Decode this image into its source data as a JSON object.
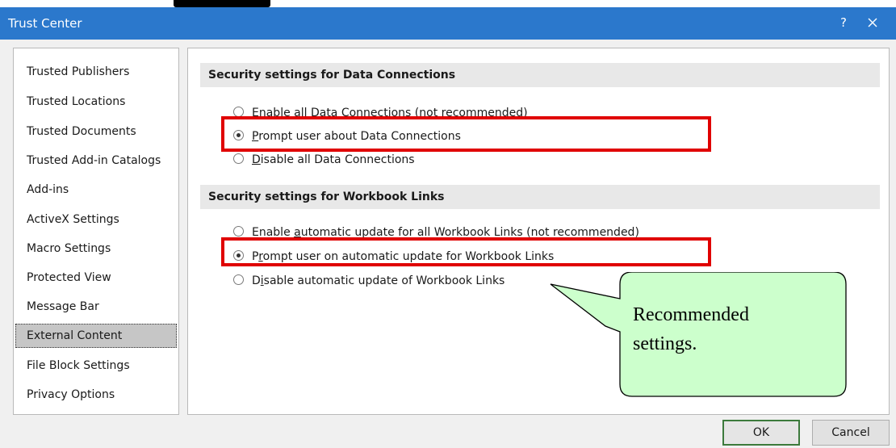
{
  "window": {
    "title": "Trust Center",
    "help_label": "?"
  },
  "sidebar": {
    "items": [
      {
        "label": "Trusted Publishers"
      },
      {
        "label": "Trusted Locations"
      },
      {
        "label": "Trusted Documents"
      },
      {
        "label": "Trusted Add-in Catalogs"
      },
      {
        "label": "Add-ins"
      },
      {
        "label": "ActiveX Settings"
      },
      {
        "label": "Macro Settings"
      },
      {
        "label": "Protected View"
      },
      {
        "label": "Message Bar"
      },
      {
        "label": "External Content",
        "selected": true
      },
      {
        "label": "File Block Settings"
      },
      {
        "label": "Privacy Options"
      }
    ]
  },
  "data_connections": {
    "header": "Security settings for Data Connections",
    "options": [
      {
        "key": "E",
        "rest": "nable all Data Connections (not recommended)",
        "selected": false
      },
      {
        "key": "P",
        "rest": "rompt user about Data Connections",
        "selected": true
      },
      {
        "key": "D",
        "rest": "isable all Data Connections",
        "selected": false
      }
    ]
  },
  "workbook_links": {
    "header": "Security settings for Workbook Links",
    "options": [
      {
        "pre": "Enable ",
        "key": "a",
        "rest": "utomatic update for all Workbook Links (not recommended)",
        "selected": false
      },
      {
        "pre": "P",
        "key": "r",
        "rest": "ompt user on automatic update for Workbook Links",
        "selected": true
      },
      {
        "pre": "D",
        "key": "i",
        "rest": "sable automatic update of Workbook Links",
        "selected": false
      }
    ]
  },
  "callout": {
    "line1": "Recommended",
    "line2": "settings."
  },
  "buttons": {
    "ok": "OK",
    "cancel": "Cancel"
  },
  "colors": {
    "titlebar": "#2b78cc",
    "highlight": "#e00000",
    "callout_fill": "#ccffcc",
    "selected_item": "#c6c6c6"
  }
}
